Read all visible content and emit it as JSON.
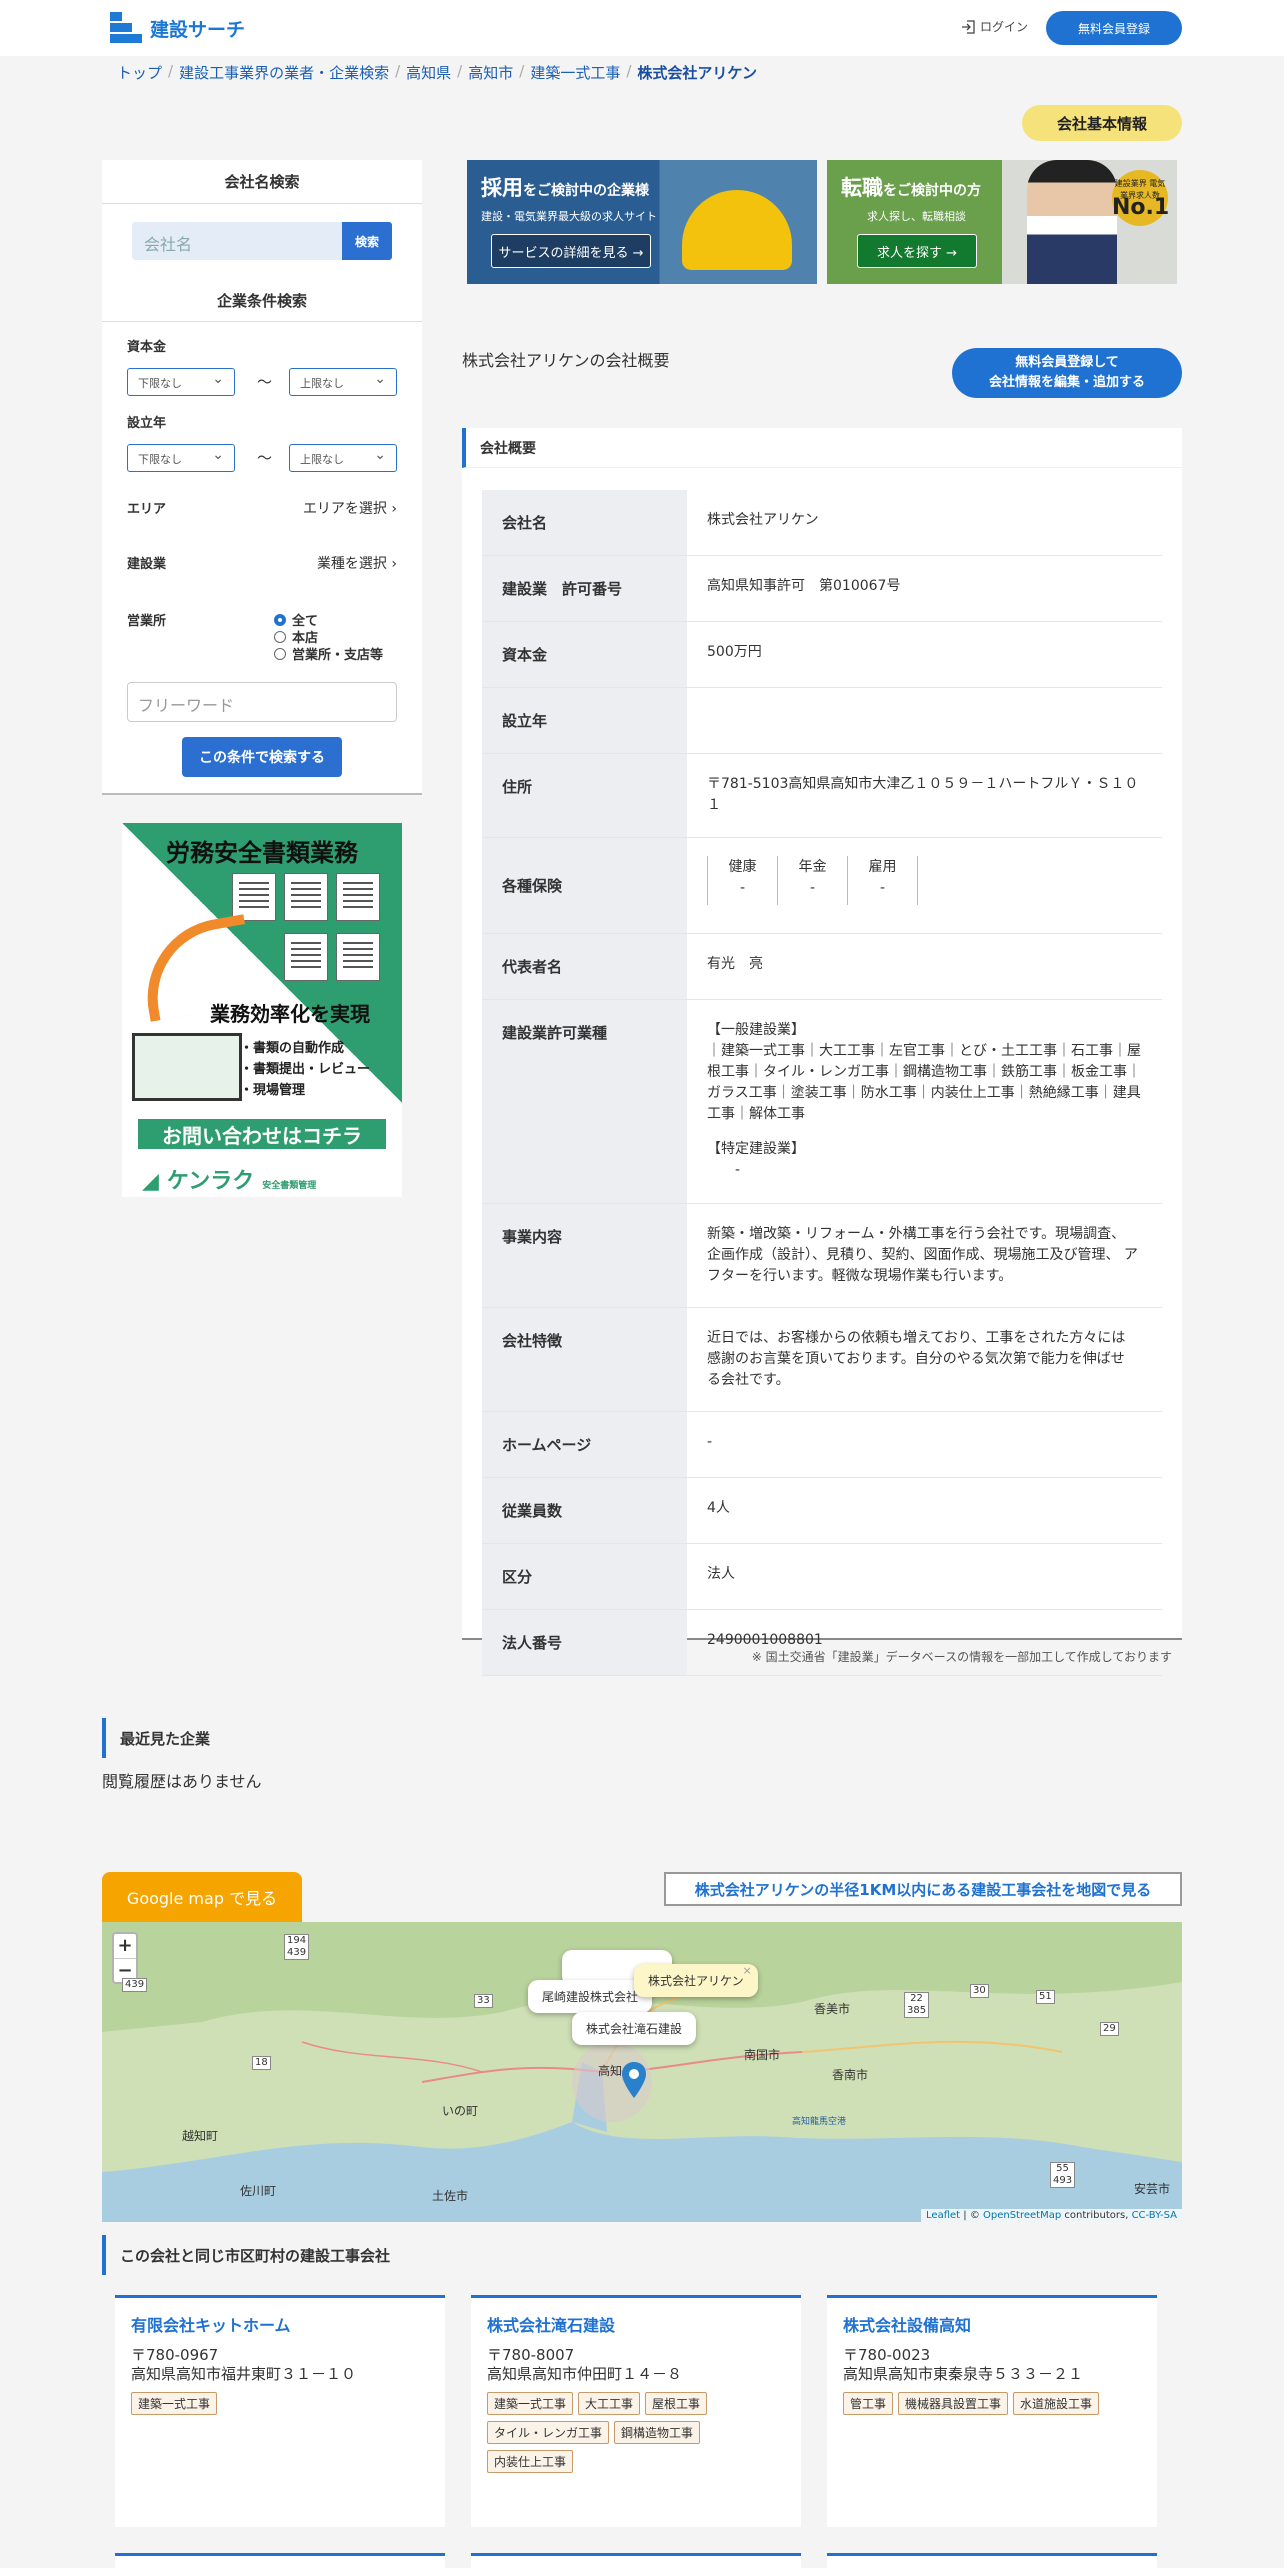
{
  "header": {
    "logo": "建設サーチ",
    "login": "ログイン",
    "register": "無料会員登録"
  },
  "breadcrumb": [
    "トップ",
    "建設工事業界の業者・企業検索",
    "高知県",
    "高知市",
    "建築一式工事",
    "株式会社アリケン"
  ],
  "badge": "会社基本情報",
  "sidebar": {
    "name_search_title": "会社名検索",
    "name_placeholder": "会社名",
    "search_btn": "検索",
    "cond_title": "企業条件検索",
    "capital_label": "資本金",
    "lower": "下限なし",
    "upper": "上限なし",
    "tilde": "〜",
    "founded_label": "設立年",
    "area_label": "エリア",
    "area_link": "エリアを選択 ›",
    "industry_label": "建設業",
    "industry_link": "業種を選択 ›",
    "office_label": "営業所",
    "office_options": [
      "全て",
      "本店",
      "営業所・支店等"
    ],
    "freeword": "フリーワード",
    "submit": "この条件で検索する"
  },
  "ad": {
    "title": "労務安全書類業務",
    "middle": "業務効率化を実現",
    "bullets": [
      "・書類の自動作成",
      "・書類提出・レビュー",
      "・現場管理"
    ],
    "cta": "お問い合わせはコチラ",
    "brand": "ケンラク",
    "brand_sub": "安全書類管理"
  },
  "banners": {
    "hire_title": "採用",
    "hire_title_rest": "をご検討中の企業様",
    "hire_sub": "建設・電気業界最大級の求人サイト",
    "hire_btn": "サービスの詳細を見る →",
    "job_title": "転職",
    "job_title_rest": "をご検討中の方",
    "job_sub": "求人探し、転職相談",
    "job_btn": "求人を探す →",
    "no1_text": "建設業界 電気業界求人数",
    "no1_big": "No.1"
  },
  "overview": {
    "title": "株式会社アリケンの会社概要",
    "edit_btn_1": "無料会員登録して",
    "edit_btn_2": "会社情報を編集・追加する",
    "panel_head": "会社概要"
  },
  "company": {
    "rows": [
      {
        "k": "会社名",
        "v": "株式会社アリケン"
      },
      {
        "k": "建設業　許可番号",
        "v": "高知県知事許可　第010067号"
      },
      {
        "k": "資本金",
        "v": "500万円"
      },
      {
        "k": "設立年",
        "v": ""
      },
      {
        "k": "住所",
        "v": "〒781-5103高知県高知市大津乙１０５９－１ハートフルＹ・Ｓ１０１"
      }
    ],
    "insurance_label": "各種保険",
    "insurance": [
      {
        "name": "健康",
        "val": "-"
      },
      {
        "name": "年金",
        "val": "-"
      },
      {
        "name": "雇用",
        "val": "-"
      }
    ],
    "rep_label": "代表者名",
    "rep": "有光　亮",
    "permit_label": "建設業許可業種",
    "permit_general_title": "【一般建設業】",
    "permit_general": "｜建築一式工事｜大工工事｜左官工事｜とび・土工工事｜石工事｜屋根工事｜タイル・レンガ工事｜鋼構造物工事｜鉄筋工事｜板金工事｜ガラス工事｜塗装工事｜防水工事｜内装仕上工事｜熱絶縁工事｜建具工事｜解体工事",
    "permit_special_title": "【特定建設業】",
    "permit_special": "-",
    "business_label": "事業内容",
    "business": "新築・増改築・リフォーム・外構工事を行う会社です。現場調査、 企画作成（設計）、見積り、契約、図面作成、現場施工及び管理、 アフターを行います。軽微な現場作業も行います。",
    "feature_label": "会社特徴",
    "feature": "近日では、お客様からの依頼も増えており、工事をされた方々には 感謝のお言葉を頂いております。自分のやる気次第で能力を伸ばせ る会社です。",
    "rows2": [
      {
        "k": "ホームページ",
        "v": "-"
      },
      {
        "k": "従業員数",
        "v": "4人"
      },
      {
        "k": "区分",
        "v": "法人"
      },
      {
        "k": "法人番号",
        "v": "2490001008801"
      }
    ]
  },
  "note": "※ 国土交通省「建設業」データベースの情報を一部加工して作成しております",
  "recent": {
    "title": "最近見た企業",
    "empty": "閲覧履歴はありません"
  },
  "map": {
    "gmap_btn": "Google map で見る",
    "radius_link": "株式会社アリケンの半径1KM以内にある建設工事会社を地図で見る",
    "zoom_in": "+",
    "zoom_out": "−",
    "popups": [
      "株式会社アリケン",
      "尾崎建設株式会社",
      "株式会社滝石建設"
    ],
    "popup_close": "×",
    "cities": [
      "香美市",
      "南国市",
      "香南市",
      "高知",
      "いの町",
      "越知町",
      "佐川町",
      "土佐市",
      "安芸市",
      "高知龍馬空港"
    ],
    "routes": [
      "194\n439",
      "33",
      "22\n385",
      "30",
      "51",
      "29",
      "18",
      "55\n493",
      "439"
    ],
    "attrib_leaflet": "Leaflet",
    "attrib_mid": " | © ",
    "attrib_osm": "OpenStreetMap",
    "attrib_tail": " contributors, ",
    "attrib_cc": "CC-BY-SA"
  },
  "same_area": {
    "title": "この会社と同じ市区町村の建設工事会社",
    "cards": [
      {
        "name": "有限会社キットホーム",
        "zip": "〒780-0967",
        "addr": "高知県高知市福井東町３１－１０",
        "tags": [
          "建築一式工事"
        ]
      },
      {
        "name": "株式会社滝石建設",
        "zip": "〒780-8007",
        "addr": "高知県高知市仲田町１４－８",
        "tags": [
          "建築一式工事",
          "大工工事",
          "屋根工事",
          "タイル・レンガ工事",
          "鋼構造物工事",
          "内装仕上工事"
        ]
      },
      {
        "name": "株式会社設備高知",
        "zip": "〒780-0023",
        "addr": "高知県高知市東秦泉寺５３３－２１",
        "tags": [
          "管工事",
          "機械器具設置工事",
          "水道施設工事"
        ]
      }
    ]
  },
  "colors": {
    "accent": "#1f72d2",
    "badge": "#f6e27a",
    "gmap": "#f5a400"
  }
}
